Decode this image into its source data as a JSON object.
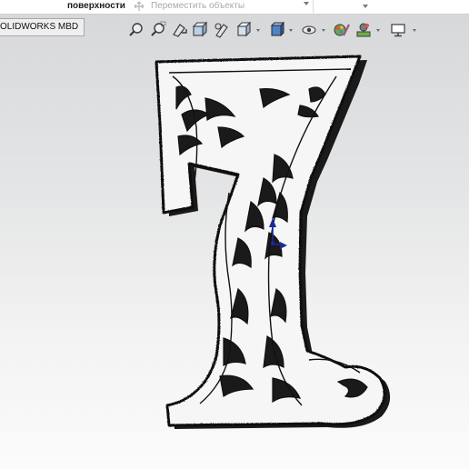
{
  "ribbon": {
    "surfaces_label": "поверхности",
    "move_objects_label": "Переместить объекты"
  },
  "tabs": {
    "mbd_label": "OLIDWORKS MBD"
  },
  "heads_up_toolbar": {
    "icons": [
      "zoom-to-fit-icon",
      "zoom-to-area-icon",
      "previous-view-icon",
      "section-view-icon",
      "dynamic-annotation-views-icon",
      "view-orientation-icon",
      "display-style-icon",
      "hide-show-items-icon",
      "edit-appearance-icon",
      "apply-scene-icon",
      "view-settings-icon"
    ]
  },
  "model": {
    "name": "decorative-number-seven",
    "colors": {
      "face": "#f6f6f6",
      "edge": "#111111",
      "extrusion": "#1a1a1a"
    }
  },
  "colors": {
    "viewport_top": "#d6d7d9",
    "viewport_bottom": "#fbfbfb",
    "triad_blue": "#1b2a9a"
  }
}
